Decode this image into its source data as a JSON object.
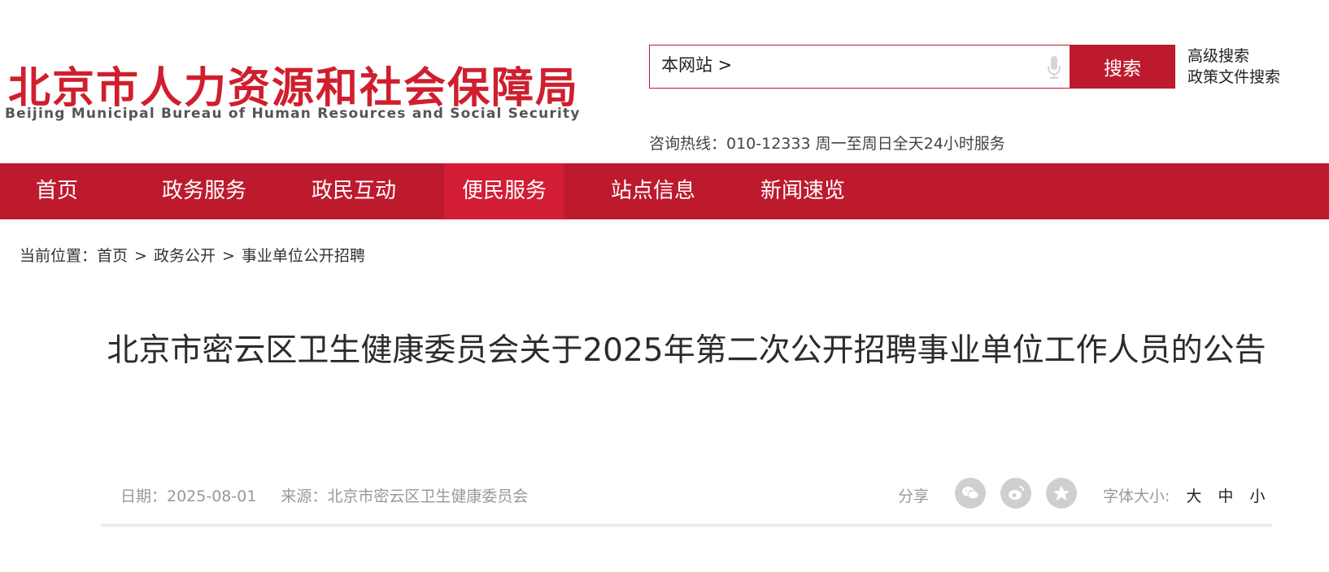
{
  "header": {
    "logo_cn": "北京市人力资源和社会保障局",
    "logo_en": "Beijing Municipal Bureau of Human Resources and Social Security",
    "search_scope": "本网站 >",
    "search_button": "搜索",
    "advanced_search": "高级搜索",
    "policy_search": "政策文件搜索",
    "hotline": "咨询热线：010-12333 周一至周日全天24小时服务"
  },
  "nav": {
    "items": [
      {
        "label": "首页"
      },
      {
        "label": "政务服务"
      },
      {
        "label": "政民互动"
      },
      {
        "label": "便民服务"
      },
      {
        "label": "站点信息"
      },
      {
        "label": "新闻速览"
      }
    ]
  },
  "breadcrumb": {
    "prefix": "当前位置：",
    "items": [
      "首页",
      "政务公开",
      "事业单位公开招聘"
    ],
    "separator": ">"
  },
  "article": {
    "title": "北京市密云区卫生健康委员会关于2025年第二次公开招聘事业单位工作人员的公告",
    "date": "日期：2025-08-01",
    "source": "来源：北京市密云区卫生健康委员会",
    "share_label": "分享",
    "font_size_label": "字体大小:",
    "font_options": [
      "大",
      "中",
      "小"
    ]
  },
  "colors": {
    "brand_red": "#bd1a2d",
    "nav_active": "#d21d35",
    "icon_gray": "#cfcfcf"
  }
}
